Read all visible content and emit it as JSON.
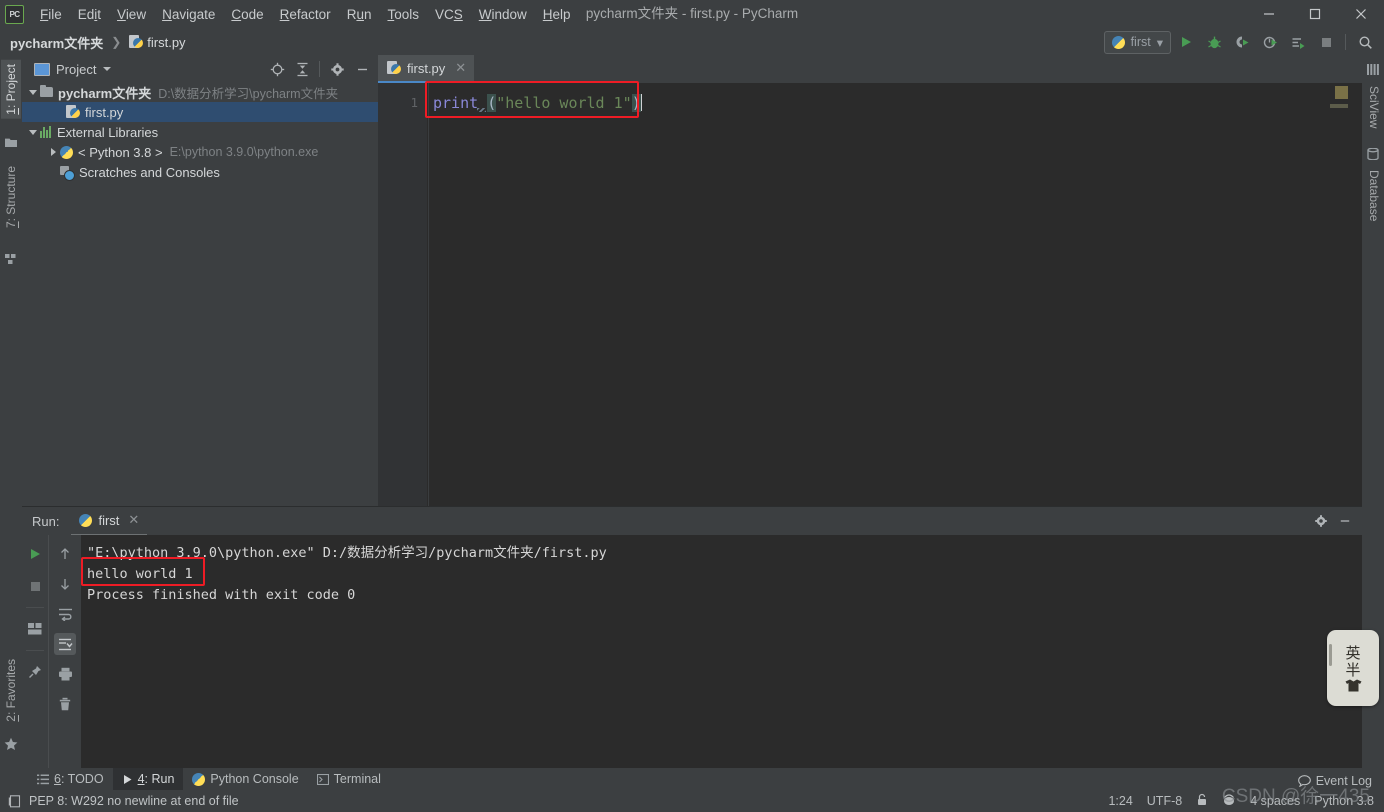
{
  "window": {
    "title": "pycharm文件夹 - first.py - PyCharm",
    "app_logo": "pycharm-logo",
    "controls": {
      "minimize": "—",
      "maximize": "▢",
      "close": "✕"
    }
  },
  "menubar": {
    "items": [
      {
        "label": "File",
        "mnemonic": "F"
      },
      {
        "label": "Edit",
        "mnemonic": "E"
      },
      {
        "label": "View",
        "mnemonic": "V"
      },
      {
        "label": "Navigate",
        "mnemonic": "N"
      },
      {
        "label": "Code",
        "mnemonic": "C"
      },
      {
        "label": "Refactor",
        "mnemonic": "R"
      },
      {
        "label": "Run",
        "mnemonic": "u"
      },
      {
        "label": "Tools",
        "mnemonic": "T"
      },
      {
        "label": "VCS",
        "mnemonic": "S"
      },
      {
        "label": "Window",
        "mnemonic": "W"
      },
      {
        "label": "Help",
        "mnemonic": "H"
      }
    ]
  },
  "navbar": {
    "breadcrumb": [
      {
        "label": "pycharm文件夹",
        "icon": "none",
        "bold": true
      },
      {
        "label": "first.py",
        "icon": "python-file-icon",
        "bold": false
      }
    ],
    "separator": "❯",
    "run_config": {
      "label": "first",
      "icon": "python-icon",
      "caret": "▾"
    },
    "buttons": [
      {
        "name": "run-button",
        "glyph": "▶"
      },
      {
        "name": "debug-button",
        "glyph": "🐞"
      },
      {
        "name": "run-coverage-button",
        "glyph": "▶"
      },
      {
        "name": "profile-button",
        "glyph": "▶"
      },
      {
        "name": "run-with-console-button",
        "glyph": "▶"
      },
      {
        "name": "stop-button",
        "glyph": "■"
      },
      {
        "name": "search-everywhere-button",
        "glyph": "🔍"
      }
    ]
  },
  "left_rail": {
    "tabs": [
      {
        "label": "1: Project",
        "mnemonic": "1",
        "active": true,
        "icon": "project-icon"
      },
      {
        "label": "7: Structure",
        "mnemonic": "7",
        "active": false,
        "icon": "structure-icon"
      }
    ],
    "bottom_tabs": [
      {
        "label": "2: Favorites",
        "mnemonic": "2",
        "icon": "star-icon"
      }
    ]
  },
  "right_rail": {
    "tabs": [
      {
        "label": "SciView",
        "icon": "sciview-icon"
      },
      {
        "label": "Database",
        "icon": "database-icon"
      }
    ]
  },
  "project_panel": {
    "title": "Project",
    "caret": "▾",
    "header_buttons": [
      {
        "name": "select-opened-file-button",
        "glyph": "⊕"
      },
      {
        "name": "collapse-all-button",
        "glyph": "⌶"
      },
      {
        "name": "settings-button",
        "glyph": "⚙"
      },
      {
        "name": "hide-button",
        "glyph": "—"
      }
    ],
    "tree": [
      {
        "indent": 0,
        "twisty": "down",
        "icon": "folder-icon",
        "label": "pycharm文件夹",
        "bold": true,
        "path": "D:\\数据分析学习\\pycharm文件夹",
        "selected": false
      },
      {
        "indent": 2,
        "twisty": "none",
        "icon": "python-file-icon",
        "label": "first.py",
        "bold": false,
        "path": "",
        "selected": true
      },
      {
        "indent": 0,
        "twisty": "down",
        "icon": "library-icon",
        "label": "External Libraries",
        "bold": false,
        "path": "",
        "selected": false
      },
      {
        "indent": 1,
        "twisty": "right",
        "icon": "python-icon",
        "label": "< Python 3.8 >",
        "bold": false,
        "path": "E:\\python 3.9.0\\python.exe",
        "selected": false
      },
      {
        "indent": 1,
        "twisty": "none",
        "icon": "scratches-icon",
        "label": "Scratches and Consoles",
        "bold": false,
        "path": "",
        "selected": false
      }
    ]
  },
  "editor": {
    "tabs": [
      {
        "label": "first.py",
        "icon": "python-file-icon",
        "close": "✕",
        "active": true
      }
    ],
    "line_numbers": [
      "1"
    ],
    "code": {
      "keyword": "print",
      "space": " ",
      "open_paren": "(",
      "string": "\"hello world 1\"",
      "close_paren": ")"
    },
    "annotation_color": "#ee1c25"
  },
  "run_window": {
    "label": "Run:",
    "tab": {
      "label": "first",
      "icon": "python-icon",
      "close": "✕"
    },
    "header_buttons": [
      {
        "name": "settings-button",
        "glyph": "⚙"
      },
      {
        "name": "hide-button",
        "glyph": "—"
      }
    ],
    "left_toolbar": [
      {
        "name": "rerun-button",
        "glyph": "▶"
      },
      {
        "name": "stop-button",
        "glyph": "■"
      },
      {
        "name": "layout-button",
        "glyph": "▤"
      },
      {
        "name": "pin-tab-button",
        "glyph": "📌"
      }
    ],
    "right_toolbar": [
      {
        "name": "up-button",
        "glyph": "↑"
      },
      {
        "name": "down-button",
        "glyph": "↓"
      },
      {
        "name": "soft-wrap-button",
        "glyph": "⏎"
      },
      {
        "name": "scroll-to-end-button",
        "glyph": "⤓",
        "active": true
      },
      {
        "name": "print-button",
        "glyph": "🖨"
      },
      {
        "name": "clear-all-button",
        "glyph": "🗑"
      }
    ],
    "console_lines": [
      "\"E:\\python 3.9.0\\python.exe\" D:/数据分析学习/pycharm文件夹/first.py",
      "hello world 1",
      "",
      "Process finished with exit code 0"
    ]
  },
  "bottom_bar": {
    "tabs": [
      {
        "label": "6: TODO",
        "mnemonic": "6",
        "icon": "todo-icon",
        "active": false
      },
      {
        "label": "4: Run",
        "mnemonic": "4",
        "icon": "run-icon",
        "active": true
      },
      {
        "label": "Python Console",
        "mnemonic": "",
        "icon": "python-icon",
        "active": false
      },
      {
        "label": "Terminal",
        "mnemonic": "",
        "icon": "terminal-icon",
        "active": false
      }
    ]
  },
  "status_bar": {
    "message": "PEP 8: W292 no newline at end of file",
    "message_icon": "inspection-icon",
    "event_log": {
      "label": "Event Log",
      "icon": "balloon-icon"
    },
    "right": [
      {
        "name": "caret-position",
        "label": "1:24"
      },
      {
        "name": "file-encoding",
        "label": "UTF-8"
      },
      {
        "name": "lock-icon",
        "label": ""
      },
      {
        "name": "git-branch",
        "label": ""
      },
      {
        "name": "indent-setting",
        "label": "4 spaces"
      },
      {
        "name": "python-interpreter",
        "label": "Python 3.8"
      }
    ]
  },
  "ime_widget": {
    "mode": "英",
    "width": "半",
    "icon": "shirt-icon"
  },
  "watermark": "CSDN @徐一435"
}
